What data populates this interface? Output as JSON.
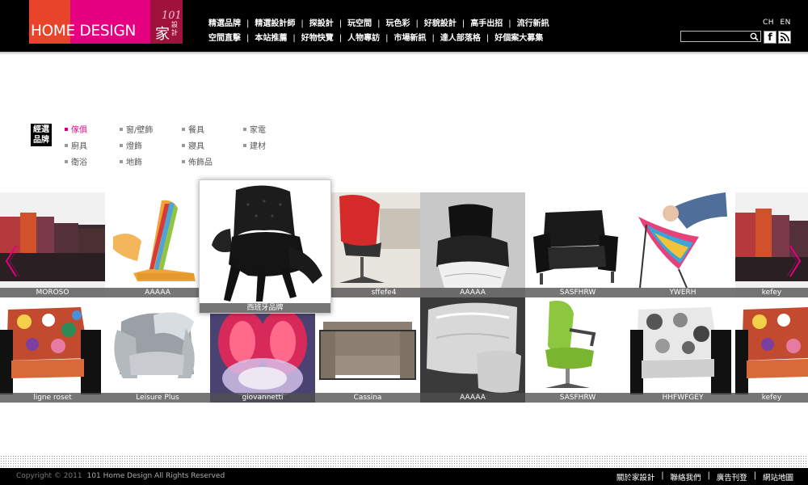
{
  "brand": {
    "name": "HOME DESIGN",
    "cn": "家",
    "cn_small": "設計",
    "number": "101"
  },
  "lang": {
    "ch": "CH",
    "en": "EN"
  },
  "nav_row1": [
    "精選品牌",
    "精選設計師",
    "探設計",
    "玩空間",
    "玩色彩",
    "好貌設計",
    "高手出招",
    "流行新訊"
  ],
  "nav_row2": [
    "空間直擊",
    "本站推薦",
    "好物快覽",
    "人物專訪",
    "市場新訊",
    "達人部落格",
    "好個案大募集"
  ],
  "search": {
    "placeholder": "",
    "value": ""
  },
  "social": {
    "facebook": "f",
    "rss": "rss"
  },
  "category_label": "經選品牌",
  "categories": [
    {
      "label": "傢俱",
      "active": true
    },
    {
      "label": "窗/壁飾",
      "active": false
    },
    {
      "label": "餐具",
      "active": false
    },
    {
      "label": "家電",
      "active": false
    },
    {
      "label": "廚具",
      "active": false
    },
    {
      "label": "燈飾",
      "active": false
    },
    {
      "label": "寢具",
      "active": false
    },
    {
      "label": "建材",
      "active": false
    },
    {
      "label": "衛浴",
      "active": false
    },
    {
      "label": "地飾",
      "active": false
    },
    {
      "label": "佈飾品",
      "active": false
    }
  ],
  "row1": [
    "MOROSO",
    "AAAAA",
    "西班牙品牌",
    "sffefe4",
    "AAAAA",
    "SASFHRW",
    "YWERH",
    "kefey"
  ],
  "featured_caption": "西班牙品牌",
  "row2": [
    "ligne roset",
    "Leisure Plus",
    "giovannetti",
    "Cassina",
    "AAAAA",
    "SASFHRW",
    "HHFWFGEY",
    "kefey"
  ],
  "colors": {
    "accent": "#e4007f",
    "header_bg": "#000000",
    "caption_bg": "#505050"
  },
  "footer": {
    "copyright": "Copyright © 2011",
    "site": "101 Home Design All Rights Reserved",
    "links": [
      "關於家設計",
      "聯絡我們",
      "廣告刊登",
      "網站地圖"
    ]
  }
}
